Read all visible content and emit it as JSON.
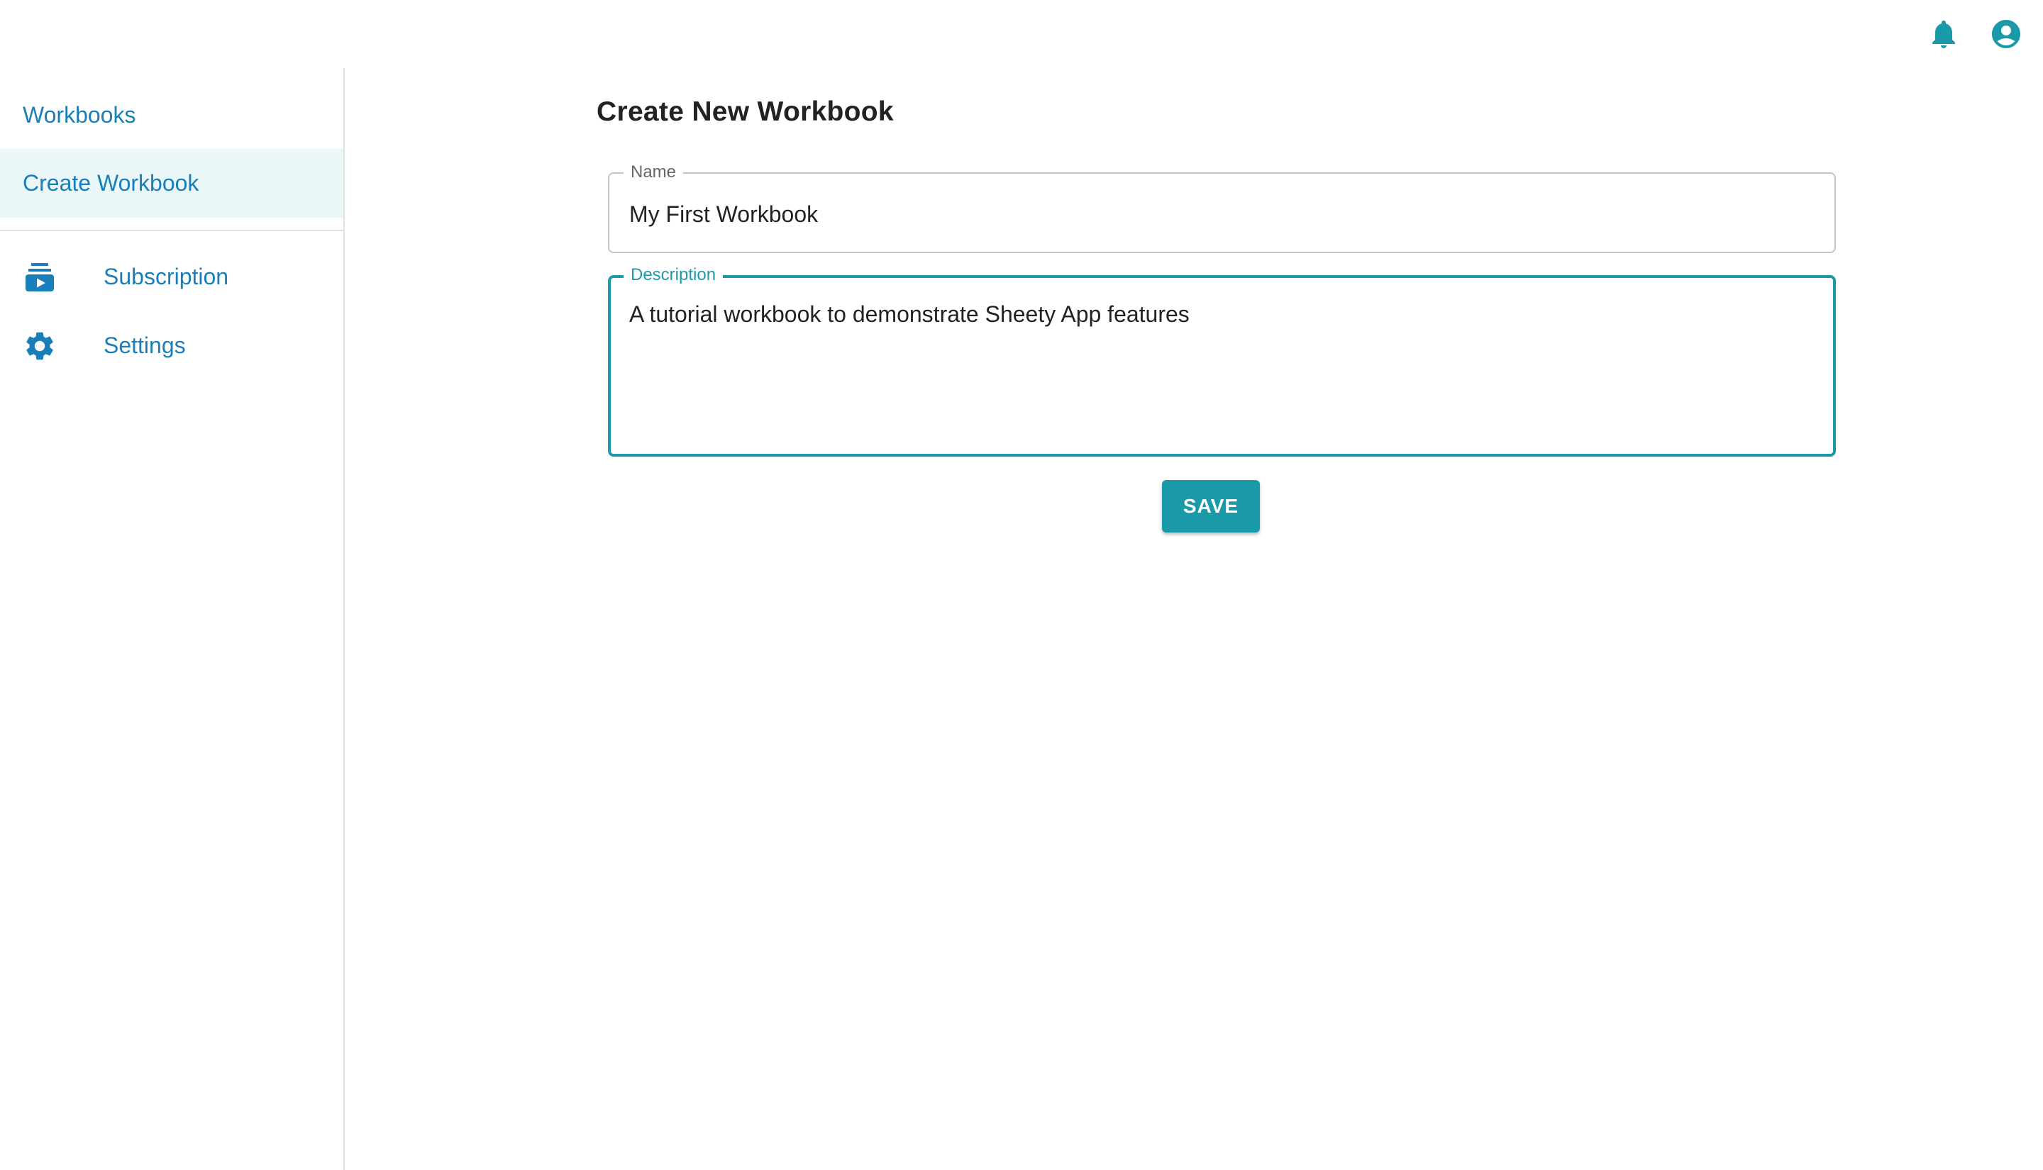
{
  "theme": {
    "accent": "#1a9aa9",
    "nav_text": "#1a7fb8",
    "active_bg": "#eaf6f8"
  },
  "topbar": {
    "icons": [
      "bell-icon",
      "account-circle-icon"
    ]
  },
  "sidebar": {
    "items": [
      {
        "label": "Workbooks",
        "icon": null,
        "active": false
      },
      {
        "label": "Create Workbook",
        "icon": null,
        "active": true
      },
      {
        "label": "Subscription",
        "icon": "subscriptions-icon",
        "active": false
      },
      {
        "label": "Settings",
        "icon": "gear-icon",
        "active": false
      }
    ]
  },
  "main": {
    "title": "Create New Workbook",
    "form": {
      "name": {
        "label": "Name",
        "value": "My First Workbook"
      },
      "description": {
        "label": "Description",
        "value": "A tutorial workbook to demonstrate Sheety App features"
      },
      "save_label": "SAVE"
    }
  }
}
